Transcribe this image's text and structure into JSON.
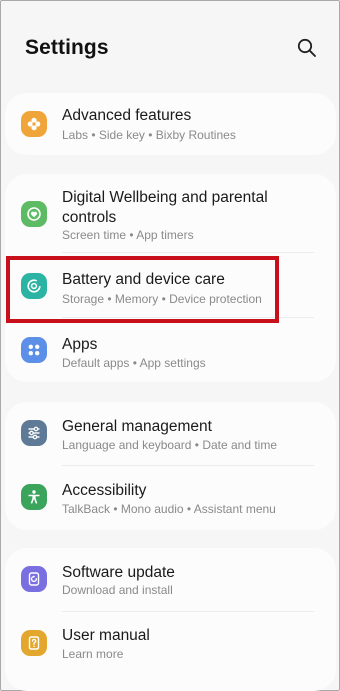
{
  "header": {
    "title": "Settings",
    "search_icon": "search-icon"
  },
  "groups": [
    {
      "items": [
        {
          "label": "Advanced features",
          "sub": "Labs  •  Side key  •  Bixby Routines",
          "icon": "advanced-features-icon",
          "color": "#f0a53a"
        }
      ]
    },
    {
      "items": [
        {
          "label": "Digital Wellbeing and parental controls",
          "sub": "Screen time  •  App timers",
          "icon": "digital-wellbeing-icon",
          "color": "#5dbb63"
        },
        {
          "label": "Battery and device care",
          "sub": "Storage  •  Memory  •  Device protection",
          "icon": "battery-care-icon",
          "color": "#2bb3a3"
        },
        {
          "label": "Apps",
          "sub": "Default apps  •  App settings",
          "icon": "apps-icon",
          "color": "#5b8fe8"
        }
      ]
    },
    {
      "items": [
        {
          "label": "General management",
          "sub": "Language and keyboard  •  Date and time",
          "icon": "general-management-icon",
          "color": "#5e7a96"
        },
        {
          "label": "Accessibility",
          "sub": "TalkBack  •  Mono audio  •  Assistant menu",
          "icon": "accessibility-icon",
          "color": "#3aa45c"
        }
      ]
    },
    {
      "items": [
        {
          "label": "Software update",
          "sub": "Download and install",
          "icon": "software-update-icon",
          "color": "#7a6fe0"
        },
        {
          "label": "User manual",
          "sub": "Learn more",
          "icon": "user-manual-icon",
          "color": "#e3a72d"
        }
      ]
    }
  ],
  "highlight_color": "#c8101c"
}
